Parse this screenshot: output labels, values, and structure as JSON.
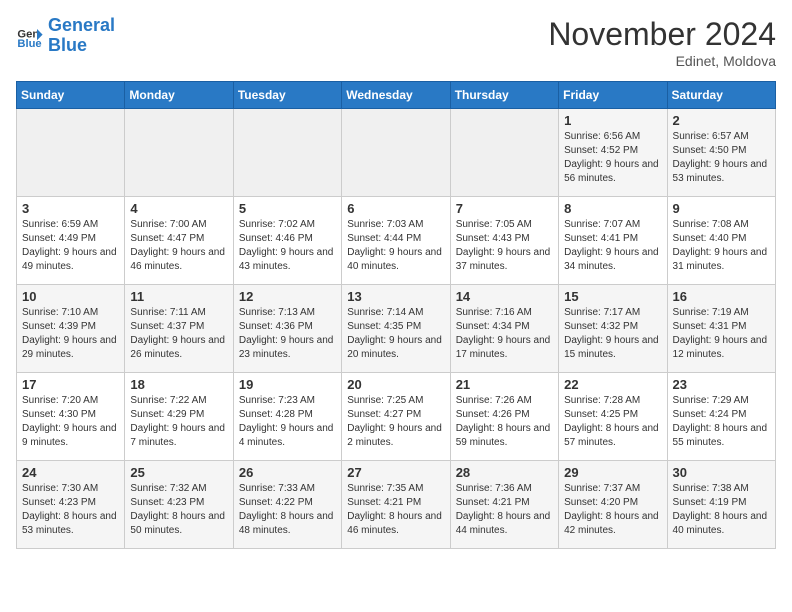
{
  "logo": {
    "line1": "General",
    "line2": "Blue"
  },
  "title": "November 2024",
  "subtitle": "Edinet, Moldova",
  "weekdays": [
    "Sunday",
    "Monday",
    "Tuesday",
    "Wednesday",
    "Thursday",
    "Friday",
    "Saturday"
  ],
  "weeks": [
    [
      {
        "day": "",
        "info": ""
      },
      {
        "day": "",
        "info": ""
      },
      {
        "day": "",
        "info": ""
      },
      {
        "day": "",
        "info": ""
      },
      {
        "day": "",
        "info": ""
      },
      {
        "day": "1",
        "info": "Sunrise: 6:56 AM\nSunset: 4:52 PM\nDaylight: 9 hours\nand 56 minutes."
      },
      {
        "day": "2",
        "info": "Sunrise: 6:57 AM\nSunset: 4:50 PM\nDaylight: 9 hours\nand 53 minutes."
      }
    ],
    [
      {
        "day": "3",
        "info": "Sunrise: 6:59 AM\nSunset: 4:49 PM\nDaylight: 9 hours\nand 49 minutes."
      },
      {
        "day": "4",
        "info": "Sunrise: 7:00 AM\nSunset: 4:47 PM\nDaylight: 9 hours\nand 46 minutes."
      },
      {
        "day": "5",
        "info": "Sunrise: 7:02 AM\nSunset: 4:46 PM\nDaylight: 9 hours\nand 43 minutes."
      },
      {
        "day": "6",
        "info": "Sunrise: 7:03 AM\nSunset: 4:44 PM\nDaylight: 9 hours\nand 40 minutes."
      },
      {
        "day": "7",
        "info": "Sunrise: 7:05 AM\nSunset: 4:43 PM\nDaylight: 9 hours\nand 37 minutes."
      },
      {
        "day": "8",
        "info": "Sunrise: 7:07 AM\nSunset: 4:41 PM\nDaylight: 9 hours\nand 34 minutes."
      },
      {
        "day": "9",
        "info": "Sunrise: 7:08 AM\nSunset: 4:40 PM\nDaylight: 9 hours\nand 31 minutes."
      }
    ],
    [
      {
        "day": "10",
        "info": "Sunrise: 7:10 AM\nSunset: 4:39 PM\nDaylight: 9 hours\nand 29 minutes."
      },
      {
        "day": "11",
        "info": "Sunrise: 7:11 AM\nSunset: 4:37 PM\nDaylight: 9 hours\nand 26 minutes."
      },
      {
        "day": "12",
        "info": "Sunrise: 7:13 AM\nSunset: 4:36 PM\nDaylight: 9 hours\nand 23 minutes."
      },
      {
        "day": "13",
        "info": "Sunrise: 7:14 AM\nSunset: 4:35 PM\nDaylight: 9 hours\nand 20 minutes."
      },
      {
        "day": "14",
        "info": "Sunrise: 7:16 AM\nSunset: 4:34 PM\nDaylight: 9 hours\nand 17 minutes."
      },
      {
        "day": "15",
        "info": "Sunrise: 7:17 AM\nSunset: 4:32 PM\nDaylight: 9 hours\nand 15 minutes."
      },
      {
        "day": "16",
        "info": "Sunrise: 7:19 AM\nSunset: 4:31 PM\nDaylight: 9 hours\nand 12 minutes."
      }
    ],
    [
      {
        "day": "17",
        "info": "Sunrise: 7:20 AM\nSunset: 4:30 PM\nDaylight: 9 hours\nand 9 minutes."
      },
      {
        "day": "18",
        "info": "Sunrise: 7:22 AM\nSunset: 4:29 PM\nDaylight: 9 hours\nand 7 minutes."
      },
      {
        "day": "19",
        "info": "Sunrise: 7:23 AM\nSunset: 4:28 PM\nDaylight: 9 hours\nand 4 minutes."
      },
      {
        "day": "20",
        "info": "Sunrise: 7:25 AM\nSunset: 4:27 PM\nDaylight: 9 hours\nand 2 minutes."
      },
      {
        "day": "21",
        "info": "Sunrise: 7:26 AM\nSunset: 4:26 PM\nDaylight: 8 hours\nand 59 minutes."
      },
      {
        "day": "22",
        "info": "Sunrise: 7:28 AM\nSunset: 4:25 PM\nDaylight: 8 hours\nand 57 minutes."
      },
      {
        "day": "23",
        "info": "Sunrise: 7:29 AM\nSunset: 4:24 PM\nDaylight: 8 hours\nand 55 minutes."
      }
    ],
    [
      {
        "day": "24",
        "info": "Sunrise: 7:30 AM\nSunset: 4:23 PM\nDaylight: 8 hours\nand 53 minutes."
      },
      {
        "day": "25",
        "info": "Sunrise: 7:32 AM\nSunset: 4:23 PM\nDaylight: 8 hours\nand 50 minutes."
      },
      {
        "day": "26",
        "info": "Sunrise: 7:33 AM\nSunset: 4:22 PM\nDaylight: 8 hours\nand 48 minutes."
      },
      {
        "day": "27",
        "info": "Sunrise: 7:35 AM\nSunset: 4:21 PM\nDaylight: 8 hours\nand 46 minutes."
      },
      {
        "day": "28",
        "info": "Sunrise: 7:36 AM\nSunset: 4:21 PM\nDaylight: 8 hours\nand 44 minutes."
      },
      {
        "day": "29",
        "info": "Sunrise: 7:37 AM\nSunset: 4:20 PM\nDaylight: 8 hours\nand 42 minutes."
      },
      {
        "day": "30",
        "info": "Sunrise: 7:38 AM\nSunset: 4:19 PM\nDaylight: 8 hours\nand 40 minutes."
      }
    ]
  ]
}
